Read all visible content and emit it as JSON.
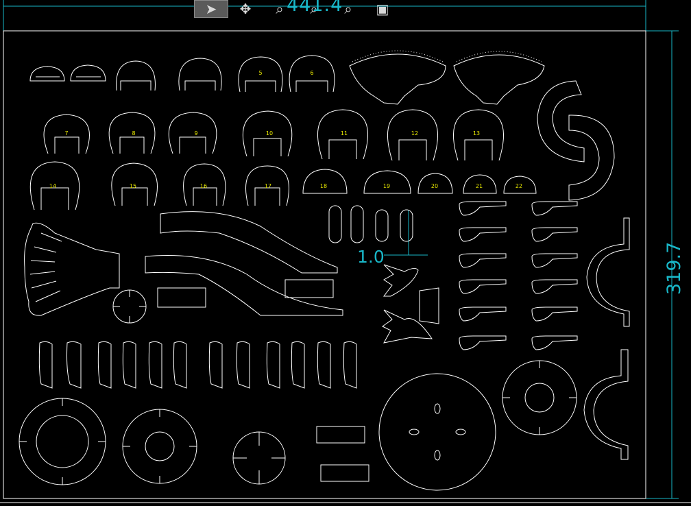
{
  "toolbar": {
    "items": [
      {
        "icon": "select-arrow-icon",
        "glyph": "➤",
        "active": true
      },
      {
        "icon": "pan-move-icon",
        "glyph": "✥",
        "active": false
      },
      {
        "icon": "zoom-window-icon",
        "glyph": "⌕",
        "active": false
      },
      {
        "icon": "zoom-in-icon",
        "glyph": "⌕",
        "active": false
      },
      {
        "icon": "zoom-out-icon",
        "glyph": "⌕",
        "active": false
      },
      {
        "icon": "layer-icon",
        "glyph": "▣",
        "active": false
      }
    ]
  },
  "dimensions": {
    "width_label": "441.4",
    "height_label": "319.7",
    "slot_label": "1.0"
  },
  "part_numbers": [
    "5",
    "6",
    "7",
    "8",
    "9",
    "10",
    "11",
    "12",
    "13",
    "14",
    "15",
    "16",
    "17",
    "18",
    "19",
    "20",
    "21",
    "22"
  ],
  "colors": {
    "background": "#000000",
    "dimension": "#19b7c8",
    "part_number": "#e8e800",
    "outline": "#ffffff"
  }
}
